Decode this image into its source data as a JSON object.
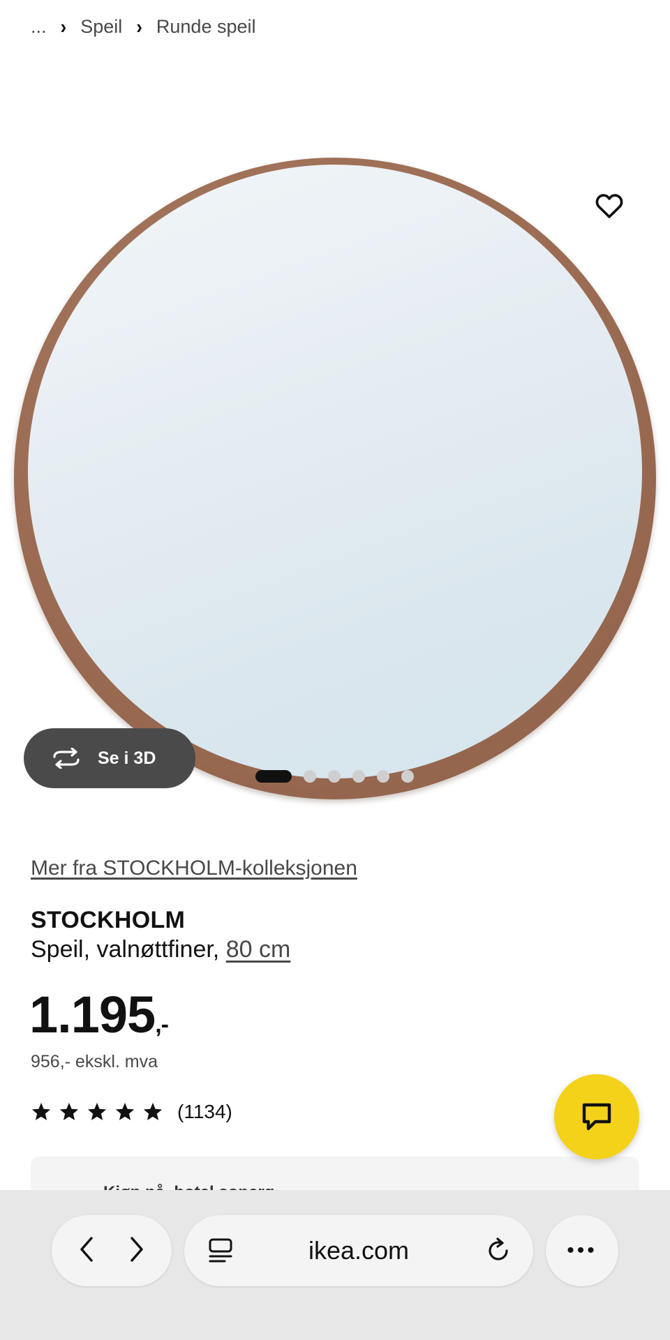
{
  "breadcrumb": {
    "ellipsis": "...",
    "items": [
      {
        "label": "Speil"
      },
      {
        "label": "Runde speil"
      }
    ]
  },
  "gallery": {
    "view_3d_label": "Se i 3D",
    "slide_count": 6,
    "active_slide": 1
  },
  "product": {
    "collection_link": "Mer fra STOCKHOLM-kolleksjonen",
    "name": "STOCKHOLM",
    "description": "Speil, valnøttfiner,",
    "size": "80 cm",
    "price": "1.195",
    "price_suffix": ",-",
    "price_ex_vat": "956,- ekskl. mva",
    "rating": 5,
    "rating_count": "(1134)"
  },
  "store_strip": {
    "label": "Kjøp nå, hotel sonerg"
  },
  "browser": {
    "url": "ikea.com",
    "more_label": "•••"
  },
  "colors": {
    "chat_button": "#f5d21a",
    "three_d_button": "#4a4a4a"
  }
}
